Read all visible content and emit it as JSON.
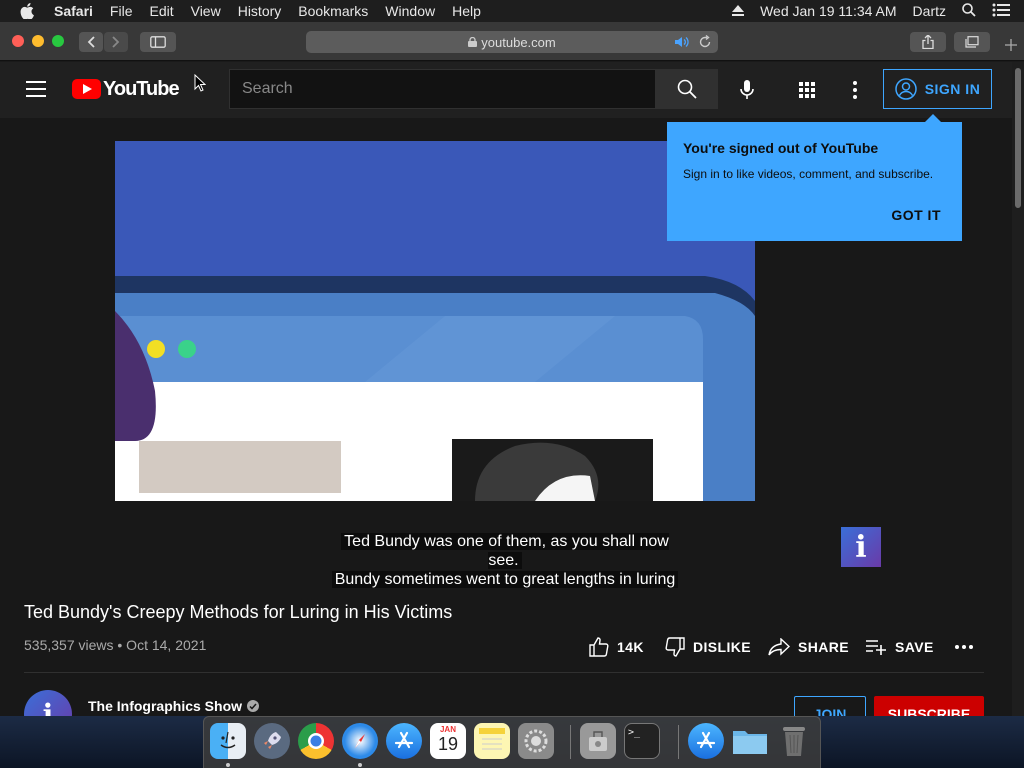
{
  "menubar": {
    "app": "Safari",
    "items": [
      "File",
      "Edit",
      "View",
      "History",
      "Bookmarks",
      "Window",
      "Help"
    ],
    "clock": "Wed Jan 19  11:34 AM",
    "user": "Dartz"
  },
  "safari": {
    "url": "youtube.com"
  },
  "youtube": {
    "logo_text": "YouTube",
    "search_placeholder": "Search",
    "sign_in_label": "SIGN IN",
    "tooltip": {
      "title": "You're signed out of YouTube",
      "body": "Sign in to like videos, comment, and subscribe.",
      "button": "GOT IT"
    },
    "captions": [
      "Ted Bundy was one of them, as you shall now see.",
      "Bundy sometimes went to great lengths in luring"
    ],
    "branding_glyph": "i",
    "video": {
      "title": "Ted Bundy's Creepy Methods for Luring in His Victims",
      "stats": "535,357 views • Oct 14, 2021",
      "likes": "14K",
      "dislike_label": "DISLIKE",
      "share_label": "SHARE",
      "save_label": "SAVE"
    },
    "channel": {
      "avatar_glyph": "i",
      "name": "The Infographics Show",
      "join_label": "JOIN",
      "subscribe_label": "SUBSCRIBE"
    }
  },
  "dock": {
    "calendar_month": "JAN",
    "calendar_day": "19",
    "terminal_prompt": ">_"
  },
  "colors": {
    "accent_blue": "#3ea6ff",
    "youtube_red": "#ff0000",
    "subscribe_red": "#cc0000",
    "background": "#181818"
  }
}
